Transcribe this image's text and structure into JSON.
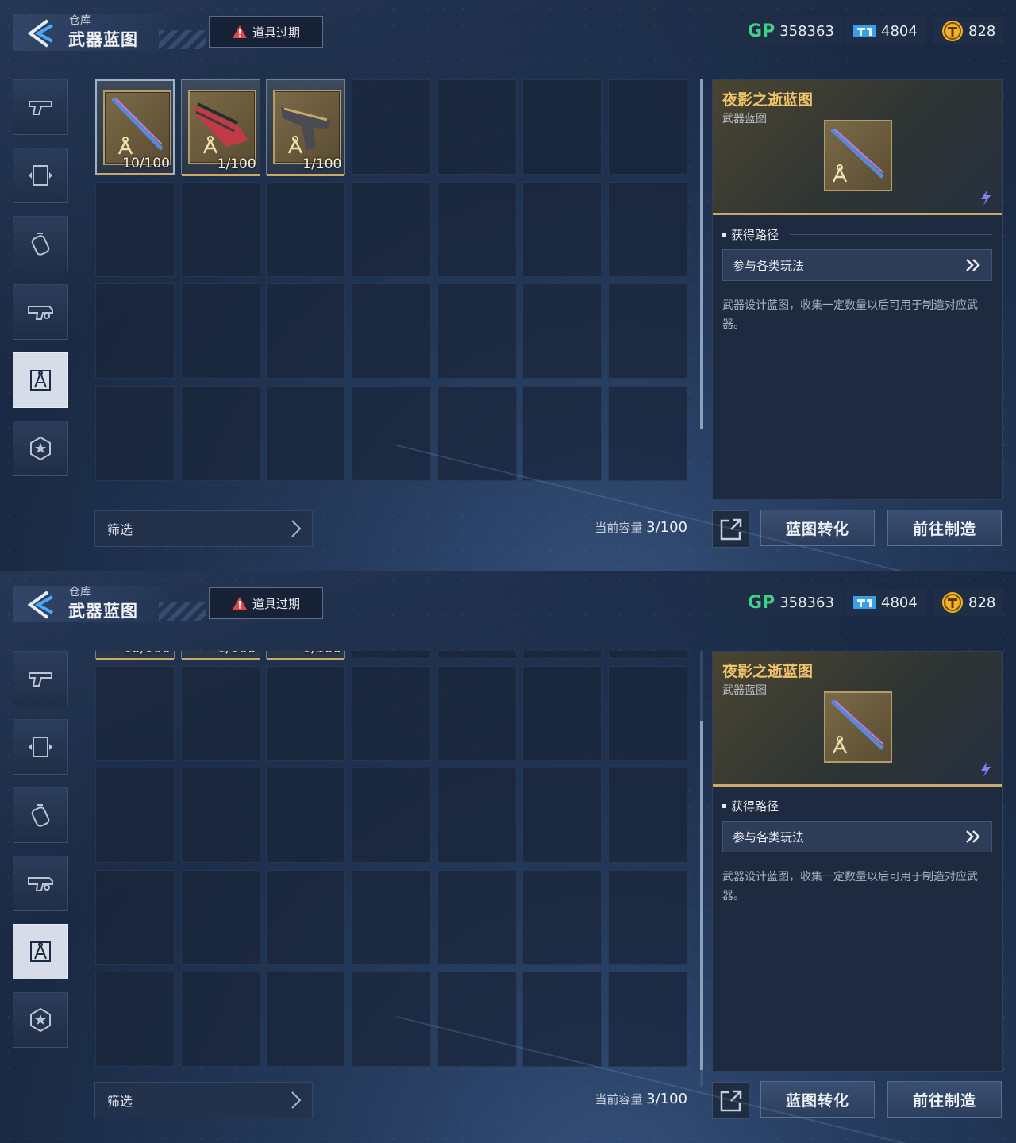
{
  "header": {
    "subtitle": "仓库",
    "title": "武器蓝图",
    "expire_label": "道具过期"
  },
  "currency": {
    "gp_icon_text": "GP",
    "gp": "358363",
    "ticket": "4804",
    "coin": "828"
  },
  "tabs": [
    {
      "icon": "pistol-icon",
      "active": false
    },
    {
      "icon": "card-frame-icon",
      "active": false
    },
    {
      "icon": "grenade-icon",
      "active": false
    },
    {
      "icon": "gun-parts-icon",
      "active": false
    },
    {
      "icon": "blueprint-compass-icon",
      "active": true
    },
    {
      "icon": "star-badge-icon",
      "active": false
    }
  ],
  "items": [
    {
      "qty": "10/100",
      "selected": true,
      "weapon": "blade-rifle"
    },
    {
      "qty": "1/100",
      "selected": false,
      "weapon": "red-cannon"
    },
    {
      "qty": "1/100",
      "selected": false,
      "weapon": "pistol"
    }
  ],
  "detail": {
    "name": "夜影之逝蓝图",
    "type": "武器蓝图",
    "source_title": "获得路径",
    "source_button": "参与各类玩法",
    "description": "武器设计蓝图，收集一定数量以后可用于制造对应武器。"
  },
  "footer": {
    "filter_label": "筛选",
    "capacity_label": "当前容量",
    "capacity_value": "3/100",
    "convert_label": "蓝图转化",
    "craft_label": "前往制造"
  },
  "colors": {
    "accent_gold": "#c9a868",
    "name_gold": "#f2c56a",
    "gp_green": "#3fd08c",
    "background": "#1c2b44"
  }
}
